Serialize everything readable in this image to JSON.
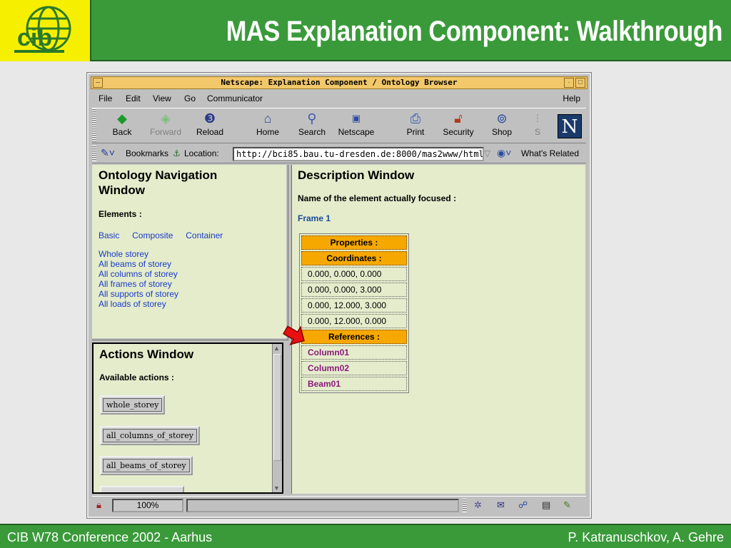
{
  "slide": {
    "title": "MAS Explanation Component: Walkthrough",
    "footer_left": "CIB W78 Conference 2002 - Aarhus",
    "footer_right": "P. Katranuschkov, A. Gehre",
    "logo_text": "cib",
    "colors": {
      "header_green": "#3a9a3a",
      "logo_yellow": "#f6f000"
    }
  },
  "browser": {
    "window_title": "Netscape: Explanation Component / Ontology Browser",
    "menu": [
      "File",
      "Edit",
      "View",
      "Go",
      "Communicator",
      "Help"
    ],
    "toolbar": [
      {
        "label": "Back",
        "icon": "back-arrow-icon"
      },
      {
        "label": "Forward",
        "icon": "forward-arrow-icon"
      },
      {
        "label": "Reload",
        "icon": "reload-icon"
      },
      {
        "label": "Home",
        "icon": "home-icon"
      },
      {
        "label": "Search",
        "icon": "search-icon"
      },
      {
        "label": "Netscape",
        "icon": "netscape-icon"
      },
      {
        "label": "Print",
        "icon": "print-icon"
      },
      {
        "label": "Security",
        "icon": "lock-icon"
      },
      {
        "label": "Shop",
        "icon": "shop-icon"
      },
      {
        "label": "S",
        "icon": "stop-icon"
      }
    ],
    "bookmarks_label": "Bookmarks",
    "location_label": "Location:",
    "url": "http://bci85.bau.tu-dresden.de:8000/mas2www/html/",
    "whats_related": "What's Related",
    "zoom": "100%"
  },
  "nav_frame": {
    "title": "Ontology Navigation Window",
    "elements_label": "Elements :",
    "categories": [
      "Basic",
      "Composite",
      "Container"
    ],
    "links": [
      "Whole storey",
      "All beams of storey",
      "All columns of storey",
      "All frames of storey",
      "All supports of storey",
      "All loads of storey"
    ]
  },
  "actions_frame": {
    "title": "Actions Window",
    "available_label": "Available actions :",
    "buttons": [
      "whole_storey",
      "all_columns_of_storey",
      "all_beams_of_storey"
    ]
  },
  "desc_frame": {
    "title": "Description Window",
    "focus_label": "Name of the element actually focused :",
    "element_name": "Frame 1",
    "properties_header": "Properties :",
    "coordinates_header": "Coordinates :",
    "coordinates": [
      "0.000, 0.000, 0.000",
      "0.000, 0.000, 3.000",
      "0.000, 12.000, 3.000",
      "0.000, 12.000, 0.000"
    ],
    "references_header": "References :",
    "references": [
      "Column01",
      "Column02",
      "Beam01"
    ]
  }
}
